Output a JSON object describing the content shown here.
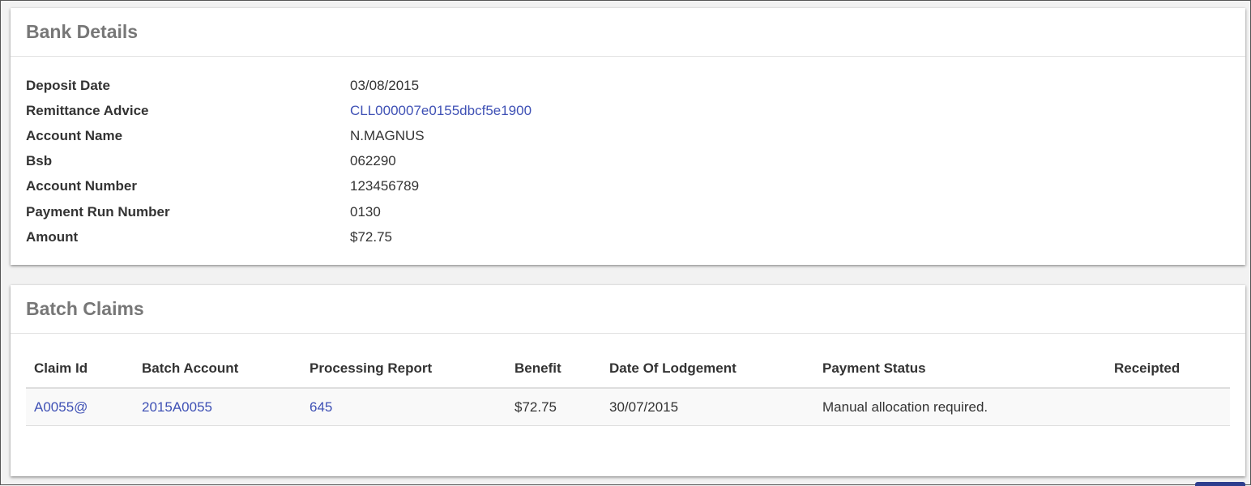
{
  "bank_details": {
    "title": "Bank Details",
    "rows": [
      {
        "label": "Deposit Date",
        "value": "03/08/2015"
      },
      {
        "label": "Remittance Advice",
        "value": "CLL000007e0155dbcf5e1900"
      },
      {
        "label": "Account Name",
        "value": "N.MAGNUS"
      },
      {
        "label": "Bsb",
        "value": "062290"
      },
      {
        "label": "Account Number",
        "value": "123456789"
      },
      {
        "label": "Payment Run Number",
        "value": "0130"
      },
      {
        "label": "Amount",
        "value": "$72.75"
      }
    ]
  },
  "batch_claims": {
    "title": "Batch Claims",
    "columns": [
      "Claim Id",
      "Batch Account",
      "Processing Report",
      "Benefit",
      "Date Of Lodgement",
      "Payment Status",
      "Receipted"
    ],
    "rows": [
      {
        "claim_id": "A0055@",
        "batch_account": "2015A0055",
        "processing_report": "645",
        "benefit": "$72.75",
        "date_of_lodgement": "30/07/2015",
        "payment_status": "Manual allocation required.",
        "receipted": ""
      }
    ]
  },
  "colors": {
    "link": "#3f51b5",
    "title": "#777777",
    "text": "#333333"
  }
}
